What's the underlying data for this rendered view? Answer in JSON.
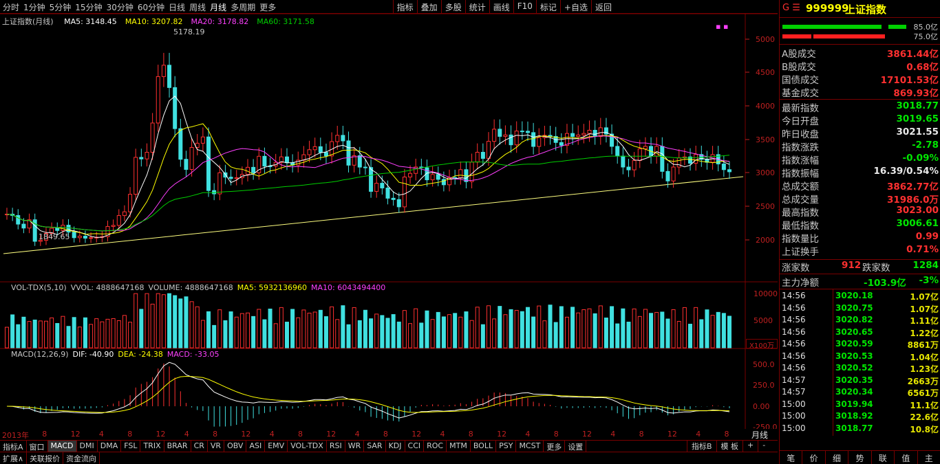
{
  "toolbar": {
    "periods": [
      "分时",
      "1分钟",
      "5分钟",
      "15分钟",
      "30分钟",
      "60分钟",
      "日线",
      "周线",
      "月线",
      "多周期",
      "更多"
    ],
    "active_period": "月线",
    "right_buttons": [
      "指标",
      "叠加",
      "多股",
      "统计",
      "画线",
      "F10",
      "标记",
      "+自选",
      "返回"
    ]
  },
  "main_chart": {
    "title": "上证指数(月线)",
    "ma_legend": [
      {
        "label": "MA5: 3148.45",
        "color": "#ffffff"
      },
      {
        "label": "MA10: 3207.82",
        "color": "#ffff00"
      },
      {
        "label": "MA20: 3178.82",
        "color": "#ff40ff"
      },
      {
        "label": "MA60: 3171.58",
        "color": "#00d000"
      }
    ],
    "high_label": "5178.19",
    "low_label": "1849.65",
    "y_ticks": [
      "5000",
      "4500",
      "4000",
      "3500",
      "3000",
      "2500",
      "2000"
    ]
  },
  "volume_chart": {
    "legend": [
      {
        "label": "VOL-TDX(5,10)",
        "color": "#c8c8c8"
      },
      {
        "label": "VVOL: 4888647168",
        "color": "#c8c8c8"
      },
      {
        "label": "VOLUME: 4888647168",
        "color": "#c8c8c8"
      },
      {
        "label": "MA5: 5932136960",
        "color": "#ffff00"
      },
      {
        "label": "MA10: 6043494400",
        "color": "#ff40ff"
      }
    ],
    "y_ticks": [
      "10000",
      "5000"
    ],
    "unit": "X100万"
  },
  "macd_chart": {
    "legend": [
      {
        "label": "MACD(12,26,9)",
        "color": "#c8c8c8"
      },
      {
        "label": "DIF: -40.90",
        "color": "#ffffff"
      },
      {
        "label": "DEA: -24.38",
        "color": "#ffff00"
      },
      {
        "label": "MACD: -33.05",
        "color": "#ff40ff"
      }
    ],
    "y_ticks": [
      "500.0",
      "250.0",
      "0.00",
      "-250.0"
    ]
  },
  "x_axis": {
    "labels": [
      "2013年",
      "8",
      "12",
      "4",
      "8",
      "12",
      "4",
      "8",
      "12",
      "4",
      "8",
      "12",
      "4",
      "8",
      "12",
      "4",
      "8",
      "12",
      "4",
      "8",
      "12",
      "4",
      "8",
      "12",
      "4",
      "8"
    ],
    "period_label": "月线"
  },
  "indicator_tabs": [
    "指标A",
    "窗口",
    "MACD",
    "DMI",
    "DMA",
    "FSL",
    "TRIX",
    "BRAR",
    "CR",
    "VR",
    "OBV",
    "ASI",
    "EMV",
    "VOL-TDX",
    "RSI",
    "WR",
    "SAR",
    "KDJ",
    "CCI",
    "ROC",
    "MTM",
    "BOLL",
    "PSY",
    "MCST",
    "更多",
    "设置"
  ],
  "indicator_tabs_right": [
    "指标B",
    "模 板",
    "+",
    "-"
  ],
  "bottom_tabs": [
    "扩展∧",
    "关联报价",
    "资金流向"
  ],
  "quote_panel": {
    "code_prefix": "G ☰",
    "code": "999999",
    "name": "上证指数",
    "bar1_pct": "85.0亿",
    "bar2_pct": "75.0亿",
    "turnover": [
      {
        "k": "A股成交",
        "v": "3861.44亿",
        "c": "red"
      },
      {
        "k": "B股成交",
        "v": "0.68亿",
        "c": "red"
      },
      {
        "k": "国债成交",
        "v": "17101.53亿",
        "c": "red"
      },
      {
        "k": "基金成交",
        "v": "869.93亿",
        "c": "red"
      }
    ],
    "stats": [
      {
        "k": "最新指数",
        "v": "3018.77",
        "c": "green"
      },
      {
        "k": "今日开盘",
        "v": "3019.65",
        "c": "green"
      },
      {
        "k": "昨日收盘",
        "v": "3021.55",
        "c": "white"
      },
      {
        "k": "指数涨跌",
        "v": "-2.78",
        "c": "green"
      },
      {
        "k": "指数涨幅",
        "v": "-0.09%",
        "c": "green"
      },
      {
        "k": "指数振幅",
        "v": "16.39/0.54%",
        "c": "white"
      },
      {
        "k": "总成交额",
        "v": "3862.77亿",
        "c": "red"
      },
      {
        "k": "总成交量",
        "v": "31986.0万",
        "c": "red"
      },
      {
        "k": "最高指数",
        "v": "3023.00",
        "c": "red"
      },
      {
        "k": "最低指数",
        "v": "3006.61",
        "c": "green"
      },
      {
        "k": "指数量比",
        "v": "0.99",
        "c": "red"
      },
      {
        "k": "上证换手",
        "v": "0.71%",
        "c": "red"
      }
    ],
    "rise_label": "涨家数",
    "rise_count": "912",
    "fall_label": "跌家数",
    "fall_count": "1284",
    "main_flow_label": "主力净额",
    "main_flow_value": "-103.9亿",
    "main_flow_pct": "-3%",
    "ticks": [
      {
        "t": "14:56",
        "p": "3020.18",
        "q": "1.07亿"
      },
      {
        "t": "14:56",
        "p": "3020.75",
        "q": "1.07亿"
      },
      {
        "t": "14:56",
        "p": "3020.82",
        "q": "1.11亿"
      },
      {
        "t": "14:56",
        "p": "3020.65",
        "q": "1.22亿"
      },
      {
        "t": "14:56",
        "p": "3020.59",
        "q": "8861万"
      },
      {
        "t": "14:56",
        "p": "3020.53",
        "q": "1.04亿"
      },
      {
        "t": "14:56",
        "p": "3020.52",
        "q": "1.23亿"
      },
      {
        "t": "14:57",
        "p": "3020.35",
        "q": "2663万"
      },
      {
        "t": "14:57",
        "p": "3020.34",
        "q": "6561万"
      },
      {
        "t": "15:00",
        "p": "3019.94",
        "q": "11.1亿"
      },
      {
        "t": "15:00",
        "p": "3018.92",
        "q": "22.6亿"
      },
      {
        "t": "15:00",
        "p": "3018.77",
        "q": "10.8亿"
      }
    ],
    "bottom_tabs": [
      "笔",
      "价",
      "细",
      "势",
      "联",
      "值",
      "主"
    ]
  },
  "colors": {
    "up": "#ff3030",
    "down": "#40e0e0",
    "grid": "#7a0000",
    "ma5": "#ffffff",
    "ma10": "#ffff00",
    "ma20": "#ff40ff",
    "ma60": "#00d000"
  }
}
